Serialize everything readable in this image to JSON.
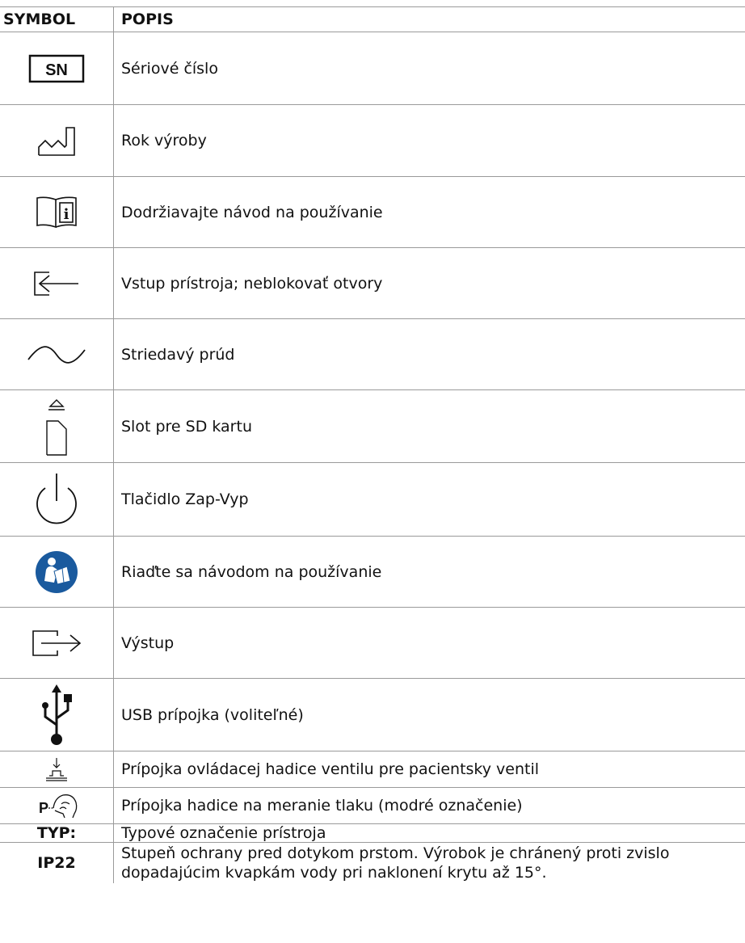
{
  "header": {
    "symbol": "SYMBOL",
    "description": "POPIS"
  },
  "rows": [
    {
      "icon": "serial-number-icon",
      "symbol_text": "SN",
      "description": "Sériové číslo"
    },
    {
      "icon": "manufacture-date-icon",
      "description": "Rok výroby"
    },
    {
      "icon": "consult-instructions-icon",
      "description": "Dodržiavajte návod na používanie"
    },
    {
      "icon": "device-input-icon",
      "description": "Vstup prístroja; neblokovať otvory"
    },
    {
      "icon": "alternating-current-icon",
      "description": "Striedavý prúd"
    },
    {
      "icon": "sd-card-slot-icon",
      "description": "Slot pre SD kartu"
    },
    {
      "icon": "power-button-icon",
      "description": "Tlačidlo Zap-Vyp"
    },
    {
      "icon": "follow-instructions-icon",
      "description": "Riaďte sa návodom na používanie",
      "color": "#1a5a9e"
    },
    {
      "icon": "output-icon",
      "description": "Výstup"
    },
    {
      "icon": "usb-icon",
      "description": "USB prípojka (voliteľné)"
    },
    {
      "icon": "valve-control-hose-icon",
      "description": "Prípojka ovládacej hadice ventilu pre pacientsky ventil"
    },
    {
      "icon": "pressure-hose-icon",
      "symbol_text": "P",
      "description": "Prípojka hadice na meranie tlaku (modré označenie)"
    },
    {
      "symbol_text": "TYP:",
      "description": "Typové označenie prístroja"
    },
    {
      "symbol_text": "IP22",
      "description": "Stupeň ochrany pred dotykom prstom. Výrobok je chránený proti zvislo dopadajúcim kvapkám vody pri naklonení krytu až 15°."
    }
  ]
}
